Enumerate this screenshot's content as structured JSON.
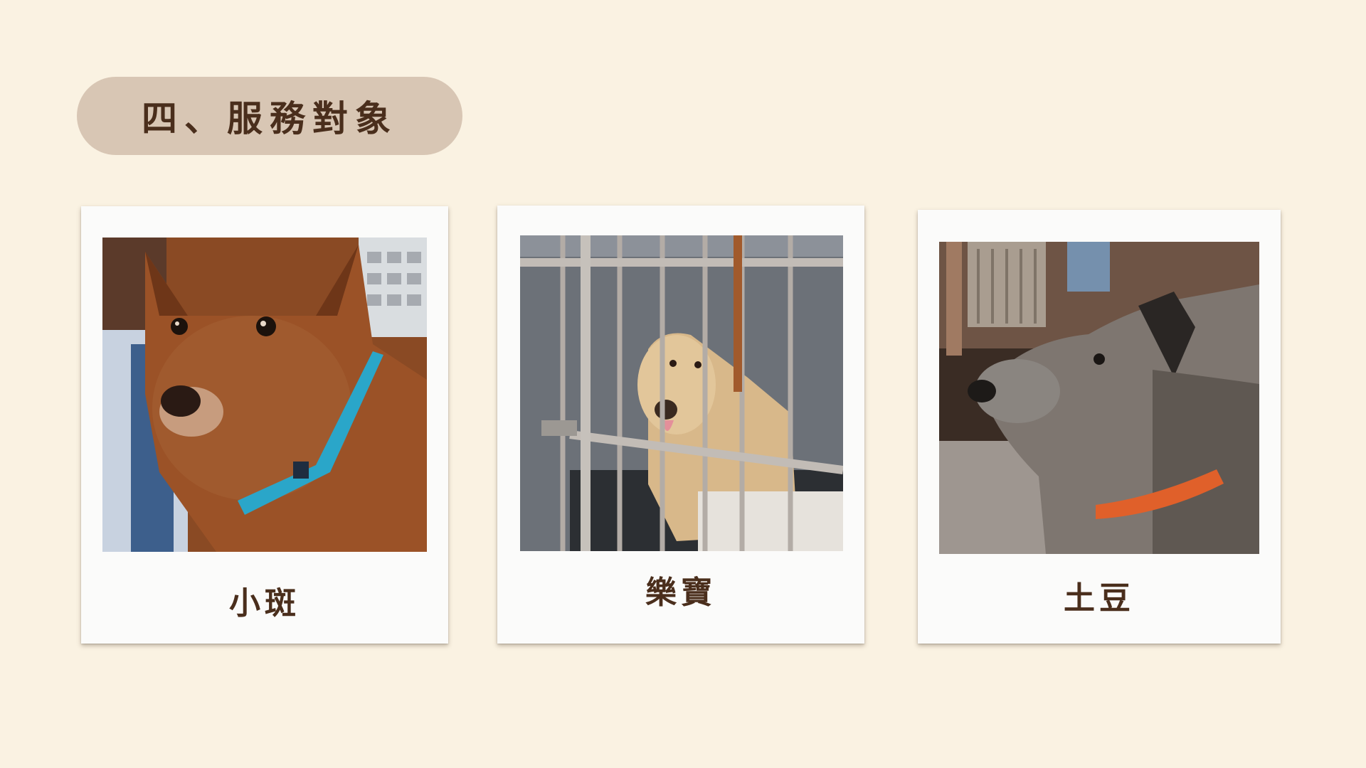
{
  "title": "四、服務對象",
  "cards": [
    {
      "name": "小斑",
      "collar_color": "#2aa6c9"
    },
    {
      "name": "樂寶",
      "collar_color": "#222222"
    },
    {
      "name": "土豆",
      "collar_color": "#e0602a"
    }
  ],
  "colors": {
    "background": "#faf2e2",
    "title_pill": "#d8c6b4",
    "title_text": "#4a2e1c",
    "card": "#fbfbfa",
    "caption_text": "#4a2e1c"
  }
}
